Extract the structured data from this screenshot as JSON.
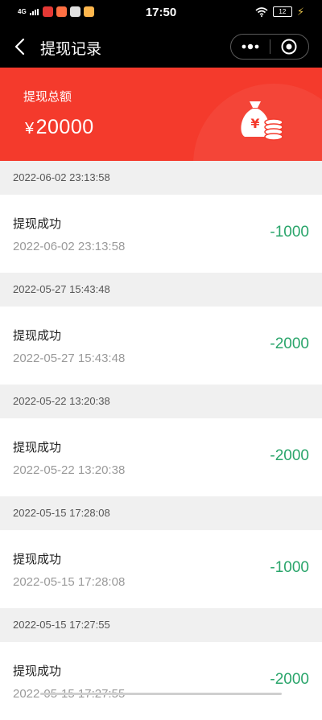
{
  "status_bar": {
    "network": "4G",
    "time": "17:50",
    "battery": "12",
    "colors": {
      "background": "#000000",
      "text": "#ffffff",
      "charging": "#e7c34a"
    }
  },
  "nav": {
    "back_icon": "chevron-left-icon",
    "title": "提现记录",
    "more_icon": "more-dots-icon",
    "close_icon": "target-close-icon"
  },
  "summary": {
    "label": "提现总额",
    "currency": "¥",
    "amount": "20000",
    "icon": "money-bag-coins-icon",
    "colors": {
      "background": "#f43a2c"
    }
  },
  "records": [
    {
      "group_date": "2022-06-02 23:13:58",
      "status": "提现成功",
      "time": "2022-06-02 23:13:58",
      "amount": "-1000"
    },
    {
      "group_date": "2022-05-27 15:43:48",
      "status": "提现成功",
      "time": "2022-05-27 15:43:48",
      "amount": "-2000"
    },
    {
      "group_date": "2022-05-22 13:20:38",
      "status": "提现成功",
      "time": "2022-05-22 13:20:38",
      "amount": "-2000"
    },
    {
      "group_date": "2022-05-15 17:28:08",
      "status": "提现成功",
      "time": "2022-05-15 17:28:08",
      "amount": "-1000"
    },
    {
      "group_date": "2022-05-15 17:27:55",
      "status": "提现成功",
      "time": "2022-05-15 17:27:55",
      "amount": "-2000"
    }
  ],
  "colors": {
    "amount_text": "#2aa56b",
    "page_background": "#f0f0f0"
  }
}
